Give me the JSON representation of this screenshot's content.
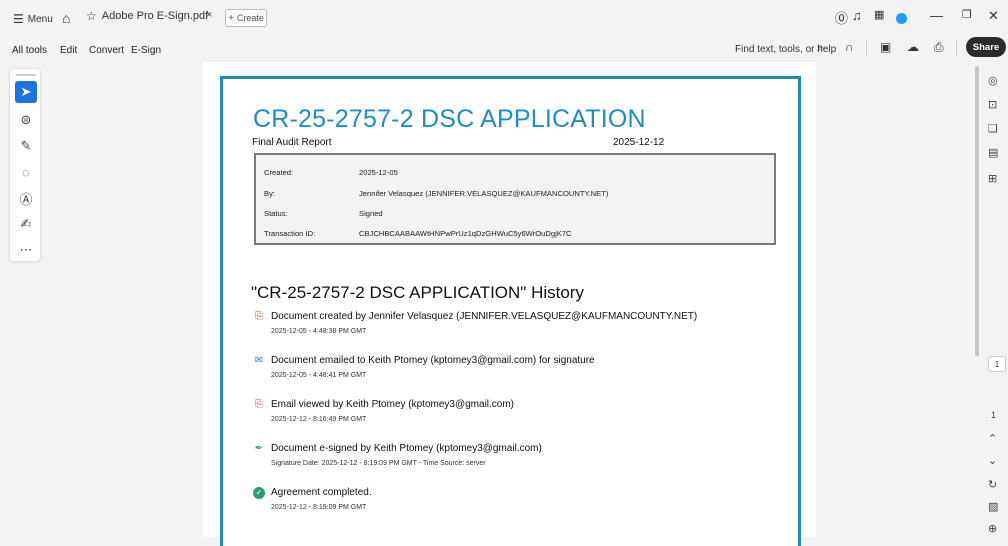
{
  "titlebar": {
    "menu_label": "Menu",
    "tab_title": "Adobe Pro E-Sign.pdf",
    "close_tab": "×",
    "create_label": "Create",
    "plus": "+"
  },
  "menubar": {
    "all_tools": "All tools",
    "edit": "Edit",
    "convert": "Convert",
    "esign": "E-Sign",
    "find_text": "Find text, tools, or help",
    "share": "Share"
  },
  "document": {
    "title": "CR-25-2757-2 DSC APPLICATION",
    "subtitle": "Final Audit Report",
    "date": "2025-12-12",
    "info": {
      "created_label": "Created:",
      "created_value": "2025-12-05",
      "by_label": "By:",
      "by_value": "Jennifer Velasquez (JENNIFER.VELASQUEZ@KAUFMANCOUNTY.NET)",
      "status_label": "Status:",
      "status_value": "Signed",
      "tid_label": "Transaction ID:",
      "tid_value": "CBJCHBCAABAAWtHNPwPrUz1qDzGHWuC5y6WrOuDgjK7C"
    },
    "history_title": "\"CR-25-2757-2 DSC APPLICATION\" History",
    "events": [
      {
        "text": "Document created by Jennifer Velasquez (JENNIFER.VELASQUEZ@KAUFMANCOUNTY.NET)",
        "time": "2025-12-05 - 4:48:38 PM GMT",
        "icon": "pdf-icon"
      },
      {
        "text": "Document emailed to Keith Ptomey (kptomey3@gmail.com) for signature",
        "time": "2025-12-05 - 4:48:41 PM GMT",
        "icon": "email-icon"
      },
      {
        "text": "Email viewed by Keith Ptomey (kptomey3@gmail.com)",
        "time": "2025-12-12 - 8:16:49 PM GMT",
        "icon": "pdf-icon"
      },
      {
        "text": "Document e-signed by Keith Ptomey (kptomey3@gmail.com)",
        "time": "Signature Date: 2025-12-12 - 8:19:09 PM GMT - Time Source: server",
        "icon": "esign-icon"
      },
      {
        "text": "Agreement completed.",
        "time": "2025-12-12 - 8:19:09 PM GMT",
        "icon": "check-circle-icon"
      }
    ]
  },
  "pager": {
    "current": "1",
    "total": "1"
  },
  "colors": {
    "accent": "#1b8ec6",
    "tool_active": "#1b74e0",
    "check_green": "#2a9d72"
  }
}
